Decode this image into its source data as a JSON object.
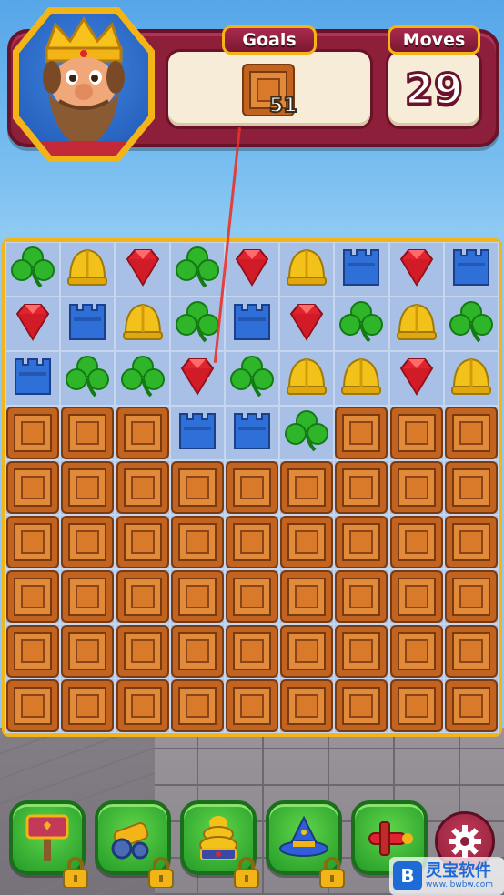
{
  "hud": {
    "goals_label": "Goals",
    "moves_label": "Moves",
    "moves_value": "29",
    "goal_item": "crate",
    "goal_count": "51"
  },
  "board": {
    "rows": [
      [
        "clover",
        "helmet",
        "gem",
        "clover",
        "gem",
        "helmet",
        "tower",
        "gem",
        "tower"
      ],
      [
        "gem",
        "tower",
        "helmet",
        "clover",
        "tower",
        "gem",
        "clover",
        "helmet",
        "clover"
      ],
      [
        "tower",
        "clover",
        "clover",
        "gem",
        "clover",
        "helmet",
        "helmet",
        "gem",
        "helmet"
      ],
      [
        "crate",
        "crate",
        "crate",
        "tower",
        "tower",
        "clover",
        "crate",
        "crate",
        "crate"
      ],
      [
        "crate",
        "crate",
        "crate",
        "crate",
        "crate",
        "crate",
        "crate",
        "crate",
        "crate"
      ],
      [
        "crate",
        "crate",
        "crate",
        "crate",
        "crate",
        "crate",
        "crate",
        "crate",
        "crate"
      ],
      [
        "crate",
        "crate",
        "crate",
        "crate",
        "crate",
        "crate",
        "crate",
        "crate",
        "crate"
      ],
      [
        "crate",
        "crate",
        "crate",
        "crate",
        "crate",
        "crate",
        "crate",
        "crate",
        "crate"
      ],
      [
        "crate",
        "crate",
        "crate",
        "crate",
        "crate",
        "crate",
        "crate",
        "crate",
        "crate"
      ]
    ]
  },
  "boosters": [
    {
      "name": "hammer",
      "locked": true
    },
    {
      "name": "cannon",
      "locked": true
    },
    {
      "name": "beehive",
      "locked": true
    },
    {
      "name": "wizard-hat",
      "locked": true
    },
    {
      "name": "airplane",
      "locked": true
    }
  ],
  "watermark": {
    "title": "灵宝软件",
    "url": "www.lbwbw.com",
    "logo": "B"
  },
  "colors": {
    "hud_bg": "#8d1f3a",
    "gold": "#f2b417",
    "board_bg": "#a9c0e6",
    "crate": "#d9792a",
    "gem": "#e0232f",
    "clover": "#2fb52a",
    "helmet": "#f2c21a",
    "tower": "#2f6fd8"
  }
}
